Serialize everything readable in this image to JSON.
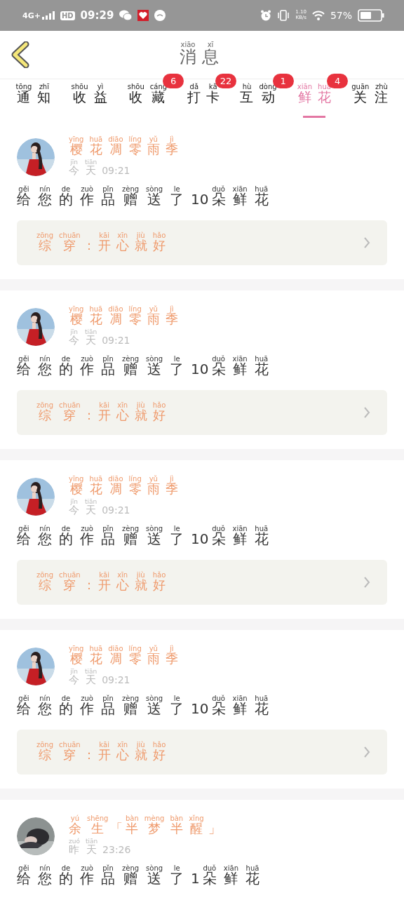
{
  "status_bar": {
    "network": "4G+",
    "hd": "HD",
    "time": "09:29",
    "speed_value": "1.10",
    "speed_unit": "KB/s",
    "battery": "57%"
  },
  "header": {
    "title": [
      [
        "xiāo",
        "消"
      ],
      [
        "xī",
        "息"
      ]
    ]
  },
  "tabs": [
    {
      "label": [
        [
          "tōng",
          "通"
        ],
        [
          "zhī",
          "知"
        ]
      ],
      "selected": false
    },
    {
      "label": [
        [
          "shōu",
          "收"
        ],
        [
          "yì",
          "益"
        ]
      ],
      "selected": false
    },
    {
      "label": [
        [
          "shōu",
          "收"
        ],
        [
          "cáng",
          "藏"
        ]
      ],
      "badge": "6",
      "selected": false
    },
    {
      "label": [
        [
          "dǎ",
          "打"
        ],
        [
          "kǎ",
          "卡"
        ]
      ],
      "badge": "22",
      "selected": false
    },
    {
      "label": [
        [
          "hù",
          "互"
        ],
        [
          "dòng",
          "动"
        ]
      ],
      "badge": "1",
      "selected": false
    },
    {
      "label": [
        [
          "xiān",
          "鲜"
        ],
        [
          "huā",
          "花"
        ]
      ],
      "badge": "4",
      "selected": true
    },
    {
      "label": [
        [
          "guān",
          "关"
        ],
        [
          "zhù",
          "注"
        ]
      ],
      "selected": false
    }
  ],
  "messages": [
    {
      "avatar": {
        "kind": "picture"
      },
      "sender": [
        [
          "yīng",
          "樱"
        ],
        [
          "huā",
          "花"
        ],
        [
          "diāo",
          "凋"
        ],
        [
          "líng",
          "零"
        ],
        [
          "yǔ",
          "雨"
        ],
        [
          "jì",
          "季"
        ]
      ],
      "day": [
        [
          "jīn",
          "今"
        ],
        [
          "tiān",
          "天"
        ]
      ],
      "time": "09:21",
      "text": [
        [
          "gěi",
          "给"
        ],
        [
          "nín",
          "您"
        ],
        [
          "de",
          "的"
        ],
        [
          "zuò",
          "作"
        ],
        [
          "pǐn",
          "品"
        ],
        [
          "zèng",
          "赠"
        ],
        [
          "sòng",
          "送"
        ],
        [
          "le",
          "了"
        ],
        [
          "10"
        ],
        [
          "duǒ",
          "朵"
        ],
        [
          "xiān",
          "鲜"
        ],
        [
          "huā",
          "花"
        ]
      ],
      "work": [
        [
          "zōng",
          "综"
        ],
        [
          "chuān",
          "穿"
        ],
        [
          "："
        ],
        [
          "kāi",
          "开"
        ],
        [
          "xīn",
          "心"
        ],
        [
          "jiù",
          "就"
        ],
        [
          "hǎo",
          "好"
        ]
      ]
    },
    {
      "avatar": {
        "kind": "picture"
      },
      "sender": [
        [
          "yīng",
          "樱"
        ],
        [
          "huā",
          "花"
        ],
        [
          "diāo",
          "凋"
        ],
        [
          "líng",
          "零"
        ],
        [
          "yǔ",
          "雨"
        ],
        [
          "jì",
          "季"
        ]
      ],
      "day": [
        [
          "jīn",
          "今"
        ],
        [
          "tiān",
          "天"
        ]
      ],
      "time": "09:21",
      "text": [
        [
          "gěi",
          "给"
        ],
        [
          "nín",
          "您"
        ],
        [
          "de",
          "的"
        ],
        [
          "zuò",
          "作"
        ],
        [
          "pǐn",
          "品"
        ],
        [
          "zèng",
          "赠"
        ],
        [
          "sòng",
          "送"
        ],
        [
          "le",
          "了"
        ],
        [
          "10"
        ],
        [
          "duǒ",
          "朵"
        ],
        [
          "xiān",
          "鲜"
        ],
        [
          "huā",
          "花"
        ]
      ],
      "work": [
        [
          "zōng",
          "综"
        ],
        [
          "chuān",
          "穿"
        ],
        [
          "："
        ],
        [
          "kāi",
          "开"
        ],
        [
          "xīn",
          "心"
        ],
        [
          "jiù",
          "就"
        ],
        [
          "hǎo",
          "好"
        ]
      ]
    },
    {
      "avatar": {
        "kind": "picture"
      },
      "sender": [
        [
          "yīng",
          "樱"
        ],
        [
          "huā",
          "花"
        ],
        [
          "diāo",
          "凋"
        ],
        [
          "líng",
          "零"
        ],
        [
          "yǔ",
          "雨"
        ],
        [
          "jì",
          "季"
        ]
      ],
      "day": [
        [
          "jīn",
          "今"
        ],
        [
          "tiān",
          "天"
        ]
      ],
      "time": "09:21",
      "text": [
        [
          "gěi",
          "给"
        ],
        [
          "nín",
          "您"
        ],
        [
          "de",
          "的"
        ],
        [
          "zuò",
          "作"
        ],
        [
          "pǐn",
          "品"
        ],
        [
          "zèng",
          "赠"
        ],
        [
          "sòng",
          "送"
        ],
        [
          "le",
          "了"
        ],
        [
          "10"
        ],
        [
          "duǒ",
          "朵"
        ],
        [
          "xiān",
          "鲜"
        ],
        [
          "huā",
          "花"
        ]
      ],
      "work": [
        [
          "zōng",
          "综"
        ],
        [
          "chuān",
          "穿"
        ],
        [
          "："
        ],
        [
          "kāi",
          "开"
        ],
        [
          "xīn",
          "心"
        ],
        [
          "jiù",
          "就"
        ],
        [
          "hǎo",
          "好"
        ]
      ]
    },
    {
      "avatar": {
        "kind": "picture"
      },
      "sender": [
        [
          "yīng",
          "樱"
        ],
        [
          "huā",
          "花"
        ],
        [
          "diāo",
          "凋"
        ],
        [
          "líng",
          "零"
        ],
        [
          "yǔ",
          "雨"
        ],
        [
          "jì",
          "季"
        ]
      ],
      "day": [
        [
          "jīn",
          "今"
        ],
        [
          "tiān",
          "天"
        ]
      ],
      "time": "09:21",
      "text": [
        [
          "gěi",
          "给"
        ],
        [
          "nín",
          "您"
        ],
        [
          "de",
          "的"
        ],
        [
          "zuò",
          "作"
        ],
        [
          "pǐn",
          "品"
        ],
        [
          "zèng",
          "赠"
        ],
        [
          "sòng",
          "送"
        ],
        [
          "le",
          "了"
        ],
        [
          "10"
        ],
        [
          "duǒ",
          "朵"
        ],
        [
          "xiān",
          "鲜"
        ],
        [
          "huā",
          "花"
        ]
      ],
      "work": [
        [
          "zōng",
          "综"
        ],
        [
          "chuān",
          "穿"
        ],
        [
          "："
        ],
        [
          "kāi",
          "开"
        ],
        [
          "xīn",
          "心"
        ],
        [
          "jiù",
          "就"
        ],
        [
          "hǎo",
          "好"
        ]
      ]
    },
    {
      "avatar": {
        "kind": "picture"
      },
      "sender": [
        [
          "yú",
          "余"
        ],
        [
          "shēng",
          "生"
        ],
        [
          "「"
        ],
        [
          "bàn",
          "半"
        ],
        [
          "mèng",
          "梦"
        ],
        [
          "bàn",
          "半"
        ],
        [
          "xǐng",
          "醒"
        ],
        [
          "」"
        ]
      ],
      "day": [
        [
          "zuó",
          "昨"
        ],
        [
          "tiān",
          "天"
        ]
      ],
      "time": "23:26",
      "text": [
        [
          "gěi",
          "给"
        ],
        [
          "nín",
          "您"
        ],
        [
          "de",
          "的"
        ],
        [
          "zuò",
          "作"
        ],
        [
          "pǐn",
          "品"
        ],
        [
          "zèng",
          "赠"
        ],
        [
          "sòng",
          "送"
        ],
        [
          "le",
          "了"
        ],
        [
          "1"
        ],
        [
          "duǒ",
          "朵"
        ],
        [
          "xiān",
          "鲜"
        ],
        [
          "huā",
          "花"
        ]
      ]
    }
  ]
}
